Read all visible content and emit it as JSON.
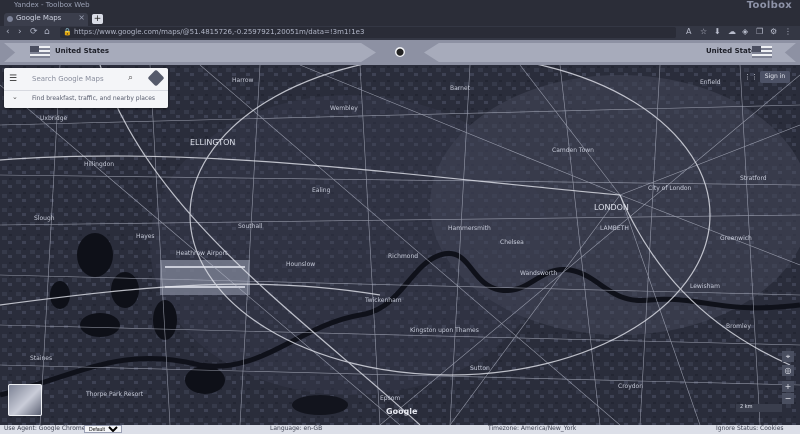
{
  "window": {
    "title": "Yandex - Toolbox Web",
    "brand": "Toolbox"
  },
  "tab": {
    "label": "Google Maps",
    "close": "×",
    "new_tab": "+"
  },
  "addressbar": {
    "back": "‹",
    "forward": "›",
    "reload": "⟳",
    "home": "⌂",
    "lock": "🔒",
    "url": "https://www.google.com/maps/@51.4815726,-0.2597921,20051m/data=!3m1!1e3"
  },
  "vpn": {
    "left_country": "United States",
    "right_country": "United States",
    "center_icon": "⬤"
  },
  "search": {
    "placeholder": "Search Google Maps",
    "hint": "Find breakfast, traffic, and nearby places"
  },
  "map_labels": [
    {
      "text": "Harrow"
    },
    {
      "text": "Wembley"
    },
    {
      "text": "Ealing"
    },
    {
      "text": "ELLINGTON"
    },
    {
      "text": "Hillingdon"
    },
    {
      "text": "Hayes"
    },
    {
      "text": "Southall"
    },
    {
      "text": "Hounslow"
    },
    {
      "text": "Richmond"
    },
    {
      "text": "Twickenham"
    },
    {
      "text": "Kingston upon Thames"
    },
    {
      "text": "LONDON"
    },
    {
      "text": "Camden Town"
    },
    {
      "text": "City of London"
    },
    {
      "text": "LAMBETH"
    },
    {
      "text": "Wandsworth"
    },
    {
      "text": "Chelsea"
    },
    {
      "text": "Hammersmith"
    },
    {
      "text": "Staines"
    },
    {
      "text": "Thorpe Park Resort"
    },
    {
      "text": "Croydon"
    },
    {
      "text": "Enfield"
    },
    {
      "text": "Barnet"
    },
    {
      "text": "Stratford"
    },
    {
      "text": "Greenwich"
    },
    {
      "text": "Lewisham"
    },
    {
      "text": "Bromley"
    },
    {
      "text": "Sutton"
    },
    {
      "text": "Epsom"
    },
    {
      "text": "Heathrow Airport"
    },
    {
      "text": "Slough"
    },
    {
      "text": "Uxbridge"
    }
  ],
  "map_ui": {
    "signin": "Sign in",
    "apps": "⋮⋮",
    "google": "Google",
    "scale": "2 km",
    "zoom_in": "+",
    "zoom_out": "−",
    "locate": "◎",
    "compass": "⌖"
  },
  "status": {
    "left1": "Use Agent: Google Chrome",
    "left2": "Use Agent",
    "select_value": "Default",
    "middle": "Language: en-GB",
    "right1": "Timezone: America/New_York",
    "right2": "Ignore Status: Cookies"
  },
  "colors": {
    "accent": "#4d5266",
    "map_bg": "#2a2d3b"
  }
}
